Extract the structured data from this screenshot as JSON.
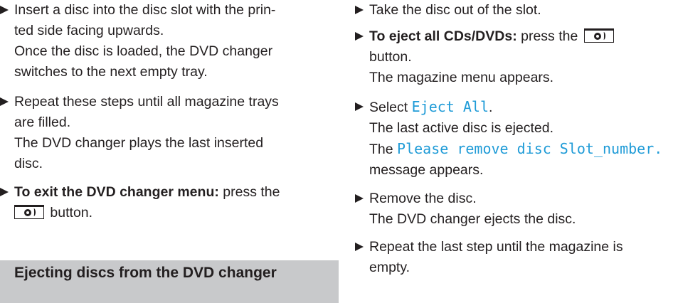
{
  "left": {
    "step1": {
      "lines": [
        "Insert a disc into the disc slot with the prin-",
        "ted side facing upwards."
      ],
      "result": [
        "Once the disc is loaded, the DVD changer",
        "switches to the next empty tray."
      ]
    },
    "step2": {
      "lines": [
        "Repeat these steps until all magazine trays",
        "are filled."
      ],
      "result": [
        "The DVD changer plays the last inserted",
        "disc."
      ]
    },
    "step3": {
      "bold": "To exit the DVD changer menu:",
      "text_before_button": "press the",
      "text_after_button": "button."
    },
    "section_heading": "Ejecting discs from the DVD changer"
  },
  "right": {
    "step1": {
      "text": "Take the disc out of the slot."
    },
    "step2": {
      "bold": "To eject all CDs/DVDs:",
      "text_before_button": "press the",
      "line2": "button.",
      "result": "The magazine menu appears."
    },
    "step3": {
      "text": "Select",
      "menu_item": "Eject All",
      "period": ".",
      "result1": "The last active disc is ejected.",
      "result2_prefix": "The",
      "result2_message": "Please remove disc Slot_number.",
      "result2_suffix": "message appears."
    },
    "step4": {
      "text": "Remove the disc.",
      "result": "The DVD changer ejects the disc."
    },
    "step5": {
      "lines": [
        "Repeat the last step until the magazine is",
        "empty."
      ]
    }
  },
  "icons": {
    "button_icon": "disc-eject-button-icon",
    "bullet": "triangle-bullet-icon"
  },
  "colors": {
    "mono_highlight": "#1f9bd7",
    "heading_bg": "#c8c9cb",
    "text": "#231f20"
  }
}
